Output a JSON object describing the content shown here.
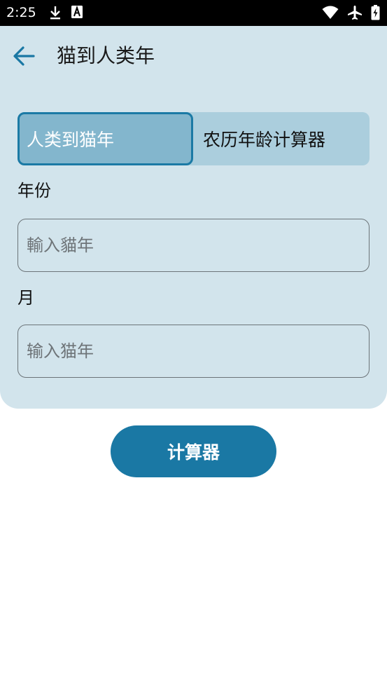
{
  "status_bar": {
    "time": "2:25",
    "icons": [
      "download-icon",
      "a-box-icon",
      "wifi-icon",
      "airplane-icon",
      "battery-icon"
    ]
  },
  "header": {
    "title": "猫到人类年",
    "back_icon": "arrow-left-icon"
  },
  "tabs": [
    {
      "label": "人类到猫年",
      "selected": true
    },
    {
      "label": "农历年龄计算器",
      "selected": false
    }
  ],
  "form": {
    "year_label": "年份",
    "year_placeholder": "輸入貓年",
    "year_value": "",
    "month_label": "月",
    "month_placeholder": "输入猫年",
    "month_value": ""
  },
  "calculate_button": {
    "label": "计算器"
  },
  "colors": {
    "accent": "#1a78a4",
    "panel_bg": "#d2e4ec",
    "tab_bg": "#abcedd",
    "tab_active_bg": "#83b6cd"
  }
}
